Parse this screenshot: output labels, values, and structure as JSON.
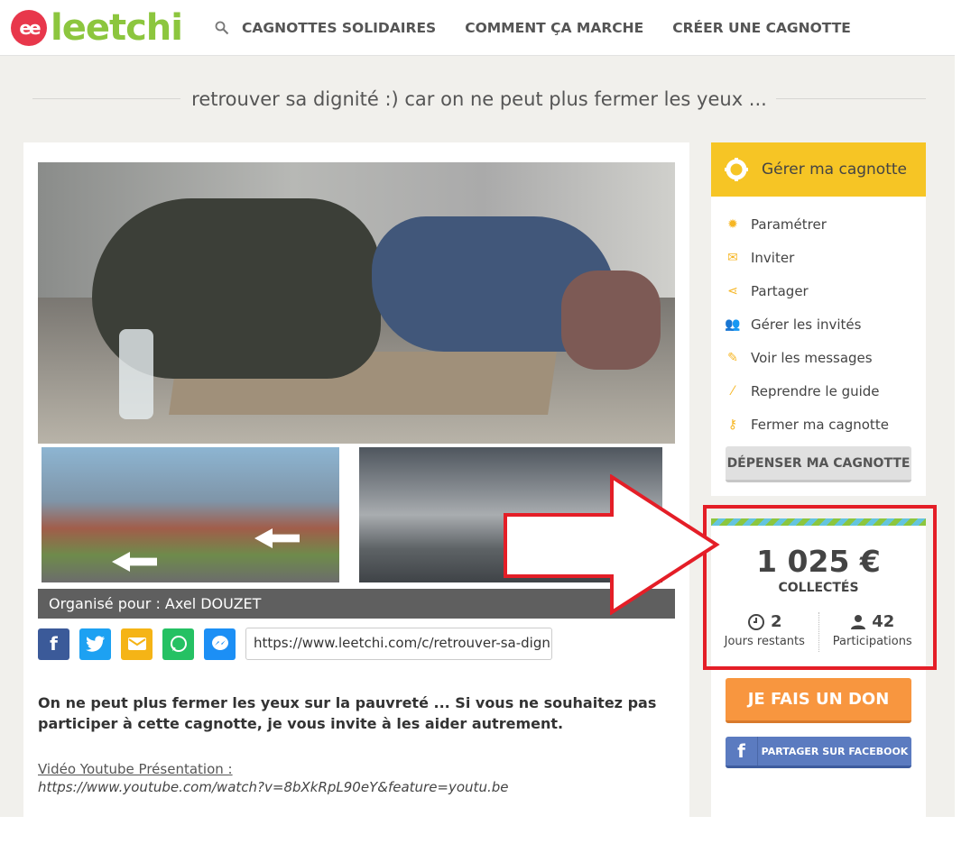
{
  "header": {
    "logo_badge": "ee",
    "logo_text": "leetchi",
    "nav": [
      {
        "label": "CAGNOTTES SOLIDAIRES"
      },
      {
        "label": "COMMENT ÇA MARCHE"
      },
      {
        "label": "CRÉER UNE CAGNOTTE"
      }
    ]
  },
  "page": {
    "title": "retrouver sa dignité :) car on ne peut plus fermer les yeux ..."
  },
  "main": {
    "organiser": "Organisé pour : Axel DOUZET",
    "share_link": "https://www.leetchi.com/c/retrouver-sa-digni...",
    "description": "On ne peut plus fermer les yeux sur la pauvreté ... Si vous ne souhaitez pas participer à cette cagnotte, je vous invite à les aider autrement.",
    "video_label": "Vidéo Youtube Présentation :",
    "video_url": "https://www.youtube.com/watch?v=8bXkRpL90eY&feature=youtu.be"
  },
  "manage": {
    "title": "Gérer ma cagnotte",
    "items": [
      {
        "label": "Paramétrer",
        "icon": "gear-icon"
      },
      {
        "label": "Inviter",
        "icon": "envelope-icon"
      },
      {
        "label": "Partager",
        "icon": "share-icon"
      },
      {
        "label": "Gérer les invités",
        "icon": "users-icon"
      },
      {
        "label": "Voir les messages",
        "icon": "edit-icon"
      },
      {
        "label": "Reprendre le guide",
        "icon": "wand-icon"
      },
      {
        "label": "Fermer ma cagnotte",
        "icon": "key-icon"
      }
    ],
    "spend_label": "DÉPENSER MA CAGNOTTE"
  },
  "stats": {
    "amount": "1 025 €",
    "collected_label": "COLLECTÉS",
    "days_value": "2",
    "days_label": "Jours restants",
    "participations_value": "42",
    "participations_label": "Participations"
  },
  "actions": {
    "donate_label": "JE FAIS UN DON",
    "facebook_label": "PARTAGER SUR FACEBOOK"
  },
  "colors": {
    "brand_green": "#8cc63e",
    "brand_red": "#e8374b",
    "yellow": "#f6c525",
    "orange": "#f8963f",
    "facebook": "#5b7bc0",
    "highlight_red": "#e41e27"
  }
}
